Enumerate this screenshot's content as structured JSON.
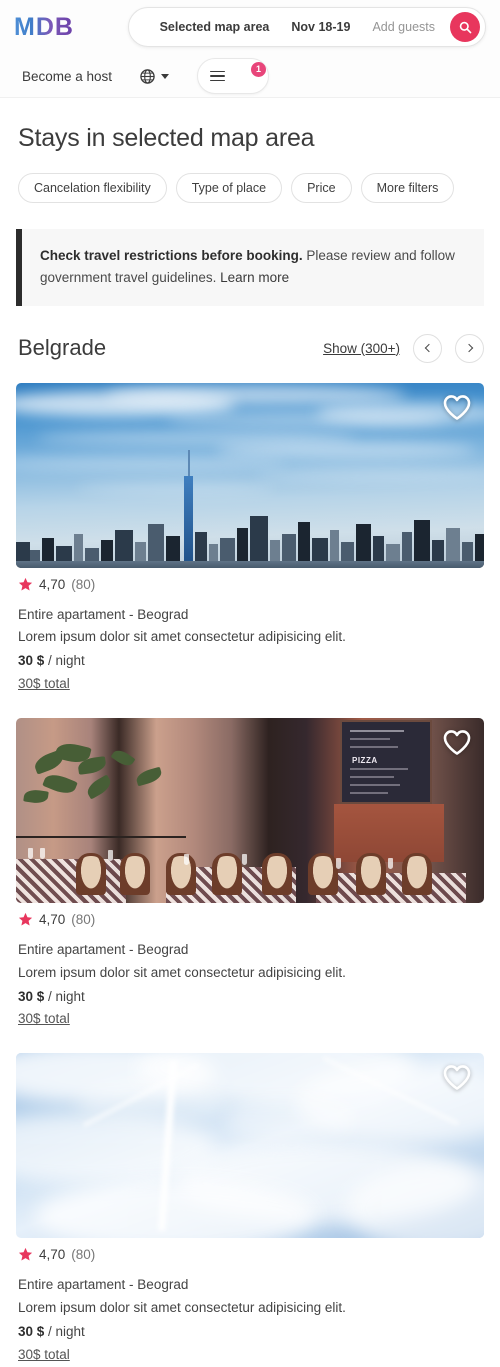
{
  "header": {
    "logo_text": "MDB",
    "search": {
      "location": "Selected map area",
      "dates": "Nov 18-19",
      "guests_placeholder": "Add guests",
      "search_icon": "search-icon"
    },
    "become_host_label": "Become a host",
    "globe_icon": "globe-icon",
    "menu_icon": "hamburger-icon",
    "avatar_icon": "avatar",
    "notification_count": "1"
  },
  "main": {
    "page_title": "Stays in selected map area",
    "filters": [
      {
        "label": "Cancelation flexibility"
      },
      {
        "label": "Type of place"
      },
      {
        "label": "Price"
      },
      {
        "label": "More filters"
      }
    ],
    "alert": {
      "strong_text": "Check travel restrictions before booking.",
      "body_text": " Please review and follow government travel guidelines. ",
      "link_text": "Learn more"
    },
    "section": {
      "title": "Belgrade",
      "show_link": "Show (300+)",
      "prev_icon": "chevron-left-icon",
      "next_icon": "chevron-right-icon"
    },
    "listings": [
      {
        "image_alt": "new-york-city-skyline",
        "favorite_icon": "heart-icon",
        "rating": "4,70",
        "review_count": "(80)",
        "title": "Entire apartament - Beograd",
        "description": "Lorem ipsum dolor sit amet consectetur adipisicing elit.",
        "price": "30 $",
        "price_unit": " / night",
        "total": "30$ total"
      },
      {
        "image_alt": "italian-cafe-terrace",
        "favorite_icon": "heart-icon",
        "rating": "4,70",
        "review_count": "(80)",
        "title": "Entire apartament - Beograd",
        "description": "Lorem ipsum dolor sit amet consectetur adipisicing elit.",
        "price": "30 $",
        "price_unit": " / night",
        "total": "30$ total"
      },
      {
        "image_alt": "cloudy-blue-sky",
        "favorite_icon": "heart-icon",
        "rating": "4,70",
        "review_count": "(80)",
        "title": "Entire apartament - Beograd",
        "description": "Lorem ipsum dolor sit amet consectetur adipisicing elit.",
        "price": "30 $",
        "price_unit": " / night",
        "total": "30$ total"
      }
    ]
  },
  "colors": {
    "accent_pink": "#e8365d",
    "badge_pink": "#e8457a",
    "star_pink": "#e8365d",
    "alert_bar": "#2c2c2c",
    "page_bg": "#ffffff"
  }
}
